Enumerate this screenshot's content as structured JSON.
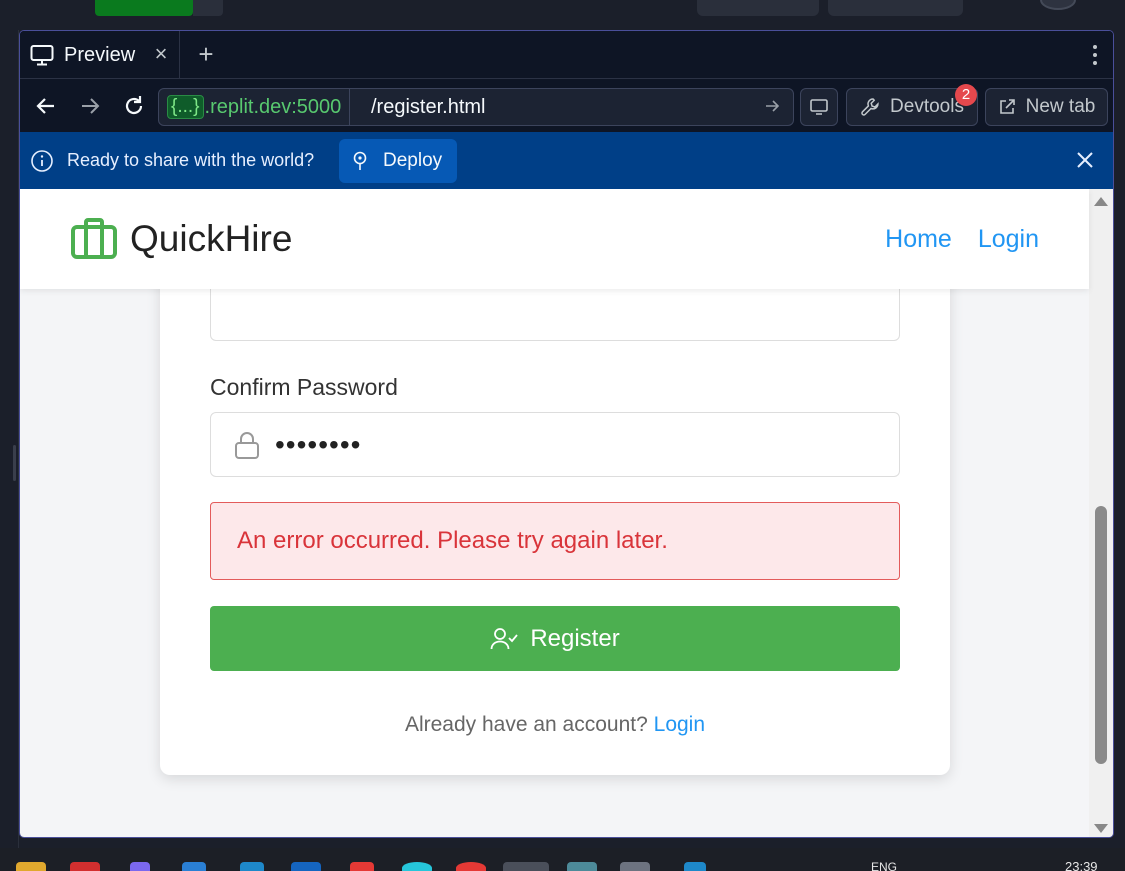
{
  "browser": {
    "tab_title": "Preview",
    "tab_icon": "monitor-icon",
    "url_host_braces": "{...}",
    "url_host": ".replit.dev:5000",
    "url_path": "/register.html",
    "devtools_label": "Devtools",
    "devtools_badge": "2",
    "new_tab_label": "New tab"
  },
  "deploy_banner": {
    "message": "Ready to share with the world?",
    "button_label": "Deploy"
  },
  "site": {
    "brand": "QuickHire",
    "nav": {
      "home": "Home",
      "login": "Login"
    }
  },
  "form": {
    "confirm_password_label": "Confirm Password",
    "confirm_password_value": "••••••••",
    "error_message": "An error occurred. Please try again later.",
    "register_button": "Register",
    "login_prompt": "Already have an account?",
    "login_link": "Login"
  },
  "taskbar": {
    "language": "ENG",
    "time": "23:39"
  },
  "colors": {
    "brand_green": "#4caf50",
    "link_blue": "#2196f3",
    "error_red": "#d9343a",
    "deploy_blue": "#003f87"
  }
}
